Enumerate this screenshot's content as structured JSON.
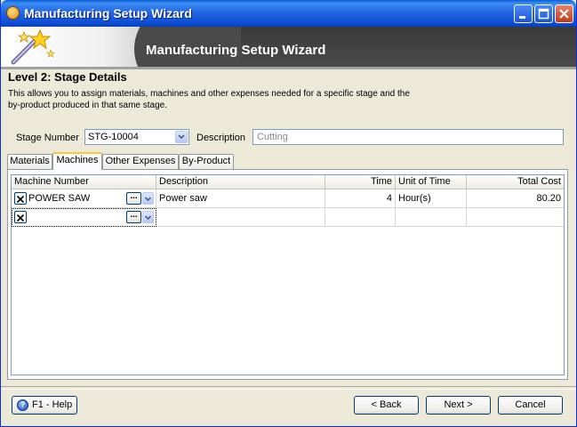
{
  "window": {
    "title": "Manufacturing Setup Wizard"
  },
  "banner": {
    "title": "Manufacturing Setup Wizard"
  },
  "level": {
    "title": "Level 2: Stage Details",
    "description": "This allows you to assign materials, machines and other expenses needed for a specific stage and the by-product produced in that same stage."
  },
  "stage": {
    "number_label": "Stage Number",
    "number_value": "STG-10004",
    "description_label": "Description",
    "description_value": "Cutting"
  },
  "tabs": [
    {
      "label": "Materials"
    },
    {
      "label": "Machines"
    },
    {
      "label": "Other Expenses"
    },
    {
      "label": "By-Product"
    }
  ],
  "active_tab": "Machines",
  "grid": {
    "columns": [
      "Machine Number",
      "Description",
      "Time",
      "Unit of Time",
      "Total Cost"
    ],
    "rows": [
      {
        "machine_number": "POWER SAW",
        "description": "Power saw",
        "time": "4",
        "unit": "Hour(s)",
        "total_cost": "80.20"
      },
      {
        "machine_number": "",
        "description": "",
        "time": "",
        "unit": "",
        "total_cost": ""
      }
    ]
  },
  "buttons": {
    "help": "F1 - Help",
    "back": "< Back",
    "next": "Next >",
    "cancel": "Cancel"
  },
  "colors": {
    "title_bar": "#0a5ed8",
    "active_tab_accent": "#ffc73c",
    "window_bg": "#ece9d8"
  }
}
